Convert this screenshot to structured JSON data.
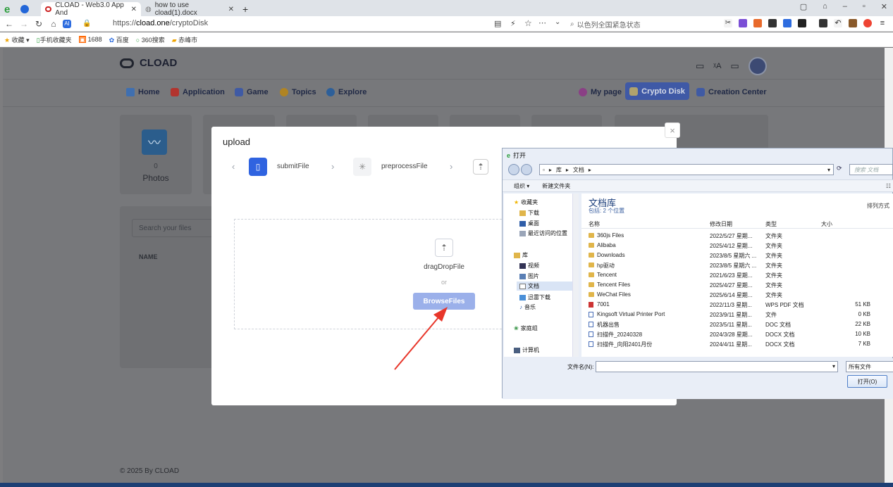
{
  "browser": {
    "tabs": [
      {
        "title": "CLOAD - Web3.0 App And"
      },
      {
        "title": "how to use cload(1).docx"
      }
    ],
    "address": {
      "prefix": "https://",
      "domain": "cload.one",
      "path": "/cryptoDisk"
    },
    "search_placeholder": "以色列全国紧急状态",
    "bookmarks": [
      "收藏",
      "手机收藏夹",
      "1688",
      "百度",
      "360搜索",
      "赤峰市"
    ]
  },
  "app": {
    "logo_text": "CLOAD",
    "nav_left": [
      "Home",
      "Application",
      "Game",
      "Topics",
      "Explore"
    ],
    "nav_right": {
      "my_page": "My page",
      "crypto_disk": "Crypto Disk",
      "creation_center": "Creation Center"
    },
    "stat": {
      "count": "0",
      "label": "Photos"
    },
    "search_placeholder": "Search your files",
    "table_header": "NAME",
    "footer": "© 2025 By CLOAD"
  },
  "upload_modal": {
    "title": "upload",
    "close_symbol": "×",
    "steps": [
      "submitFile",
      "preprocessFile"
    ],
    "dropzone_label": "dragDropFile",
    "or": "or",
    "browse_label": "BrowseFiles"
  },
  "file_dialog": {
    "title": "打开",
    "path": [
      "库",
      "文档"
    ],
    "search_placeholder": "搜索 文档",
    "toolbar": [
      "组织 ▾",
      "新建文件夹"
    ],
    "sidebar": [
      {
        "label": "收藏夹",
        "level": 0
      },
      {
        "label": "下载",
        "level": 1
      },
      {
        "label": "桌面",
        "level": 1
      },
      {
        "label": "最近访问的位置",
        "level": 1
      },
      {
        "label": "库",
        "level": 0
      },
      {
        "label": "视频",
        "level": 1
      },
      {
        "label": "图片",
        "level": 1
      },
      {
        "label": "文档",
        "level": 1
      },
      {
        "label": "迅雷下载",
        "level": 1
      },
      {
        "label": "音乐",
        "level": 1
      },
      {
        "label": "家庭组",
        "level": 0
      },
      {
        "label": "计算机",
        "level": 0
      }
    ],
    "library_title": "文档库",
    "library_sub": "包括: 2 个位置",
    "arrange": "排列方式",
    "columns": [
      "名称",
      "修改日期",
      "类型",
      "大小"
    ],
    "rows": [
      {
        "name": "360js Files",
        "date": "2022/5/27 星期...",
        "type": "文件夹",
        "size": "",
        "kind": "folder"
      },
      {
        "name": "Alibaba",
        "date": "2025/4/12 星期...",
        "type": "文件夹",
        "size": "",
        "kind": "folder"
      },
      {
        "name": "Downloads",
        "date": "2023/8/5 星期六 ...",
        "type": "文件夹",
        "size": "",
        "kind": "folder"
      },
      {
        "name": "hp驱动",
        "date": "2023/8/5 星期六 ...",
        "type": "文件夹",
        "size": "",
        "kind": "folder"
      },
      {
        "name": "Tencent",
        "date": "2021/6/23 星期...",
        "type": "文件夹",
        "size": "",
        "kind": "folder"
      },
      {
        "name": "Tencent Files",
        "date": "2025/4/27 星期...",
        "type": "文件夹",
        "size": "",
        "kind": "folder"
      },
      {
        "name": "WeChat Files",
        "date": "2025/6/14 星期...",
        "type": "文件夹",
        "size": "",
        "kind": "folder"
      },
      {
        "name": "7001",
        "date": "2022/11/3 星期...",
        "type": "WPS PDF 文档",
        "size": "51 KB",
        "kind": "pdf"
      },
      {
        "name": "Kingsoft Virtual Printer Port",
        "date": "2023/9/11 星期...",
        "type": "文件",
        "size": "0 KB",
        "kind": "file"
      },
      {
        "name": "机器出售",
        "date": "2023/5/11 星期...",
        "type": "DOC 文档",
        "size": "22 KB",
        "kind": "doc"
      },
      {
        "name": "扫描件_20240328",
        "date": "2024/3/28 星期...",
        "type": "DOCX 文档",
        "size": "10 KB",
        "kind": "doc"
      },
      {
        "name": "扫描件_向阳2401月份",
        "date": "2024/4/11 星期...",
        "type": "DOCX 文档",
        "size": "7 KB",
        "kind": "doc"
      }
    ],
    "filename_label": "文件名(N):",
    "filetype": "所有文件",
    "open_button": "打开(O)"
  }
}
